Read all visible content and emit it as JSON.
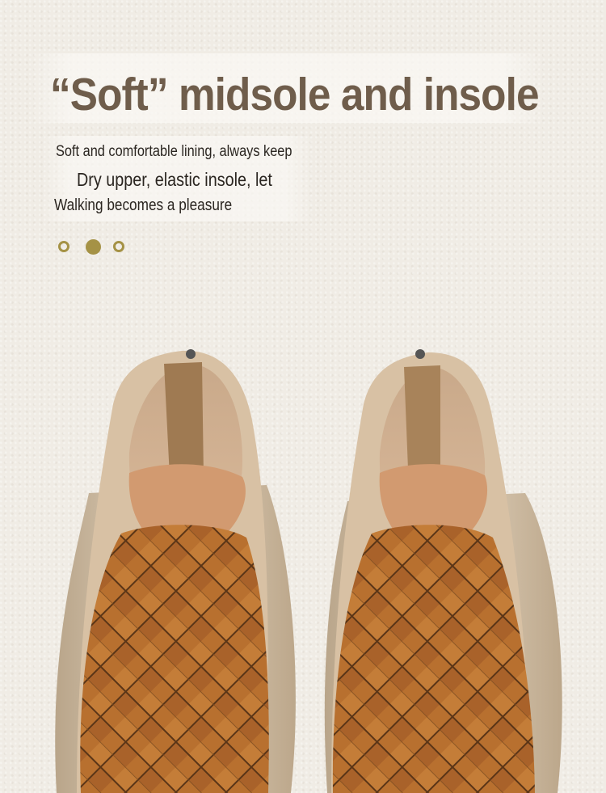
{
  "title": "“Soft” midsole and insole",
  "copy": {
    "line1": "Soft and comfortable lining, always keep",
    "line2": "Dry upper, elastic insole, let",
    "line3": "Walking becomes a pleasure"
  },
  "indicator": {
    "count": 3,
    "active_index": 1,
    "color": "#a59245"
  },
  "colors": {
    "background": "#f0ece5",
    "title": "#6f5d4b",
    "leather": "#b36a2a",
    "sole": "#d9c7ae"
  }
}
